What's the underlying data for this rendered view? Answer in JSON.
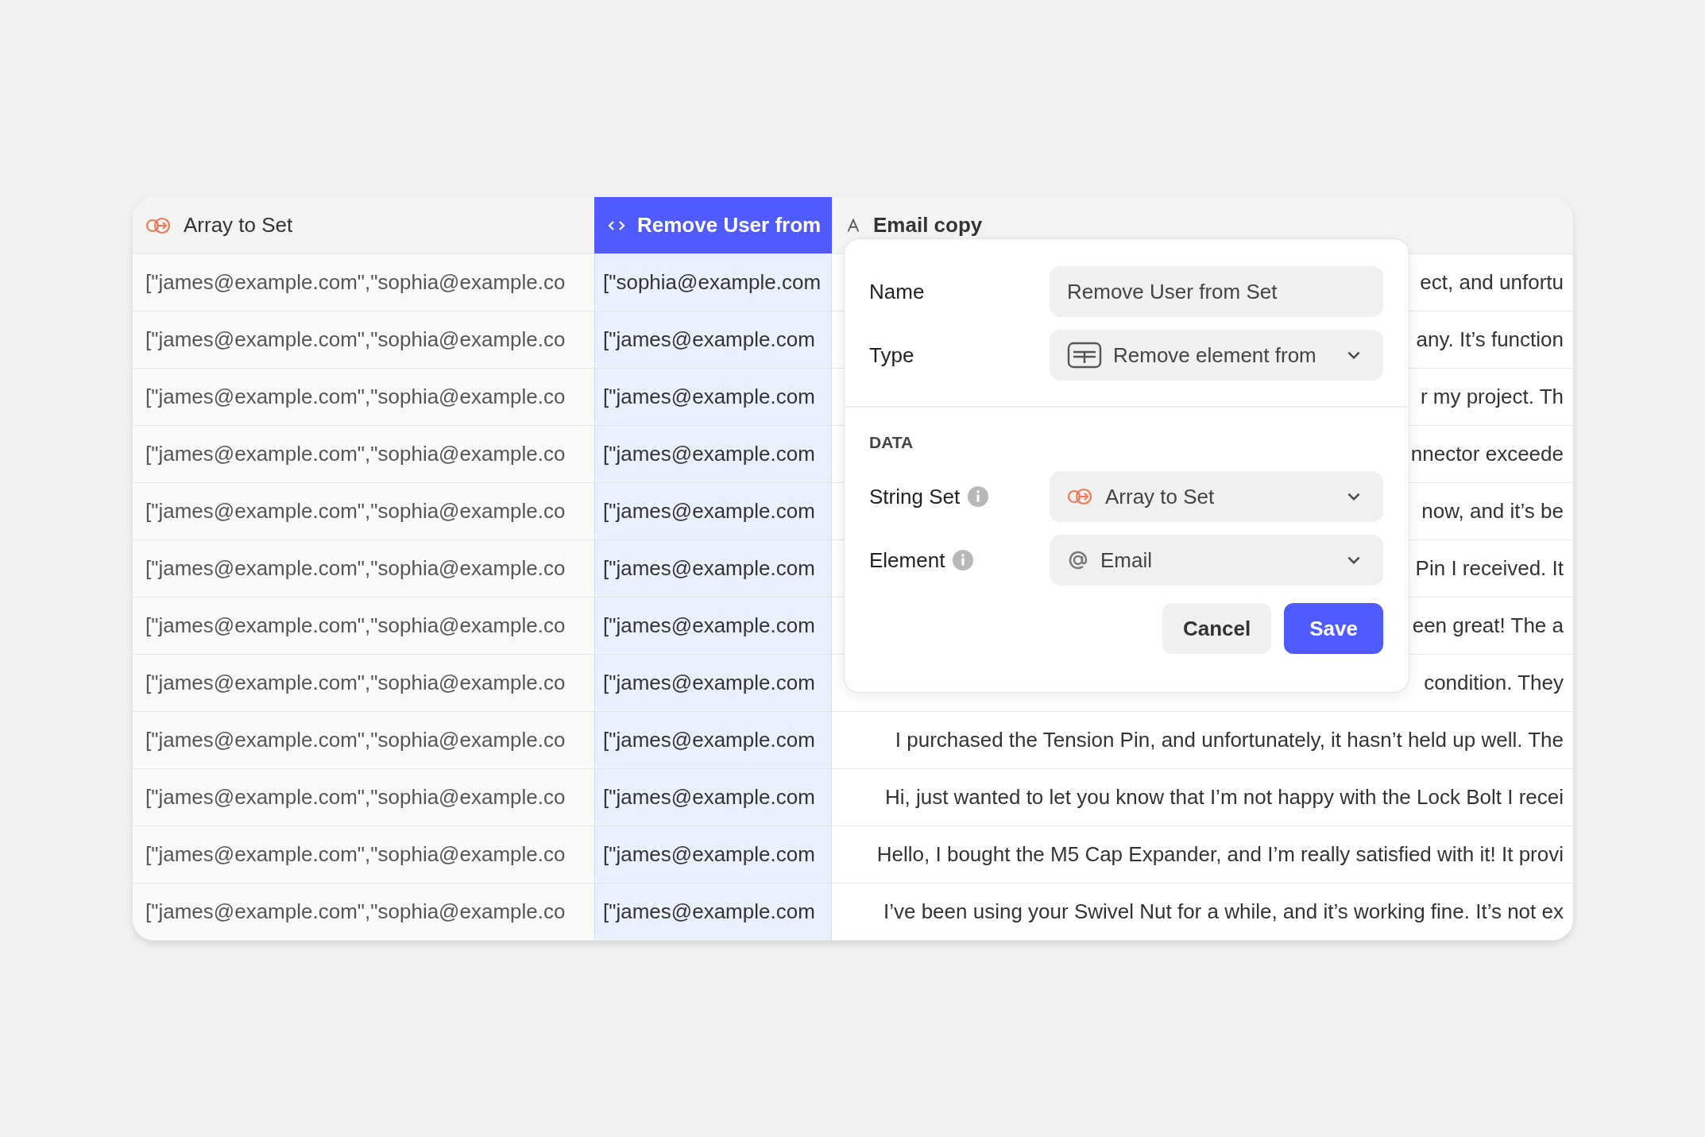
{
  "table": {
    "columns": [
      {
        "label": "Array to Set",
        "selected": false
      },
      {
        "label": "Remove User from",
        "selected": true
      },
      {
        "label": "Email copy",
        "selected": false
      }
    ],
    "rows": [
      [
        "[\"james@example.com\",\"sophia@example.co",
        "[\"sophia@example.com",
        "ect, and unfortu"
      ],
      [
        "[\"james@example.com\",\"sophia@example.co",
        "[\"james@example.com",
        "any. It’s function"
      ],
      [
        "[\"james@example.com\",\"sophia@example.co",
        "[\"james@example.com",
        "r my project. Th"
      ],
      [
        "[\"james@example.com\",\"sophia@example.co",
        "[\"james@example.com",
        "nnector exceede"
      ],
      [
        "[\"james@example.com\",\"sophia@example.co",
        "[\"james@example.com",
        "now, and it’s be"
      ],
      [
        "[\"james@example.com\",\"sophia@example.co",
        "[\"james@example.com",
        "Pin I received. It"
      ],
      [
        "[\"james@example.com\",\"sophia@example.co",
        "[\"james@example.com",
        "een great! The a"
      ],
      [
        "[\"james@example.com\",\"sophia@example.co",
        "[\"james@example.com",
        "condition. They"
      ],
      [
        "[\"james@example.com\",\"sophia@example.co",
        "[\"james@example.com",
        "I purchased the Tension Pin, and unfortunately, it hasn’t held up well. The"
      ],
      [
        "[\"james@example.com\",\"sophia@example.co",
        "[\"james@example.com",
        "Hi, just wanted to let you know that I’m not happy with the Lock Bolt I recei"
      ],
      [
        "[\"james@example.com\",\"sophia@example.co",
        "[\"james@example.com",
        "Hello, I bought the M5 Cap Expander, and I’m really satisfied with it! It provi"
      ],
      [
        "[\"james@example.com\",\"sophia@example.co",
        "[\"james@example.com",
        "I’ve been using your Swivel Nut for a while, and it’s working fine. It’s not ex"
      ]
    ]
  },
  "popup": {
    "fields": [
      {
        "label": "Name",
        "kind": "text",
        "value": "Remove User from Set"
      },
      {
        "label": "Type",
        "kind": "select",
        "value": "Remove element from"
      }
    ],
    "section": "DATA",
    "data_fields": [
      {
        "label": "String Set",
        "kind": "select",
        "value": "Array to Set",
        "info": true
      },
      {
        "label": "Element",
        "kind": "select",
        "value": "Email",
        "info": true
      }
    ],
    "buttons": [
      {
        "label": "Cancel",
        "kind": "secondary"
      },
      {
        "label": "Save",
        "kind": "primary"
      }
    ]
  }
}
